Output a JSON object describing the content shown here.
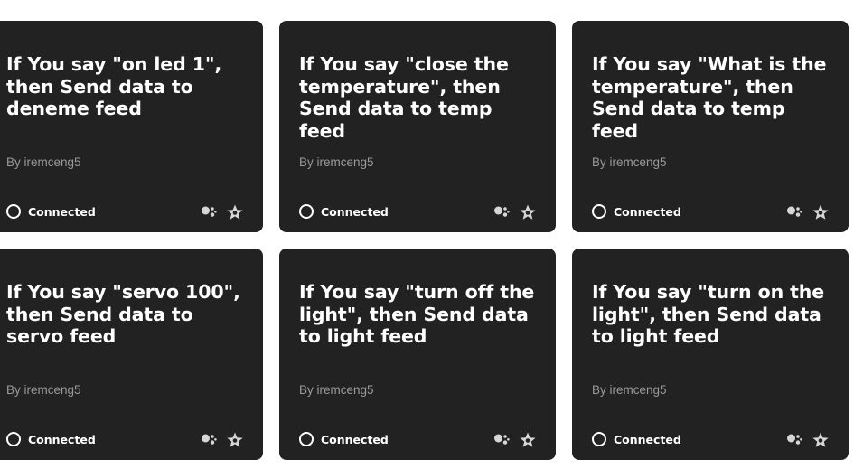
{
  "cards": [
    {
      "title": "If You say \"on led 1\", then Send data to deneme feed",
      "author": "By iremceng5",
      "status": "Connected",
      "service_icons": [
        "google-assistant-icon",
        "adafruit-star-icon"
      ]
    },
    {
      "title": "If You say \"close the temperature\", then Send data to temp feed",
      "author": "By iremceng5",
      "status": "Connected",
      "service_icons": [
        "google-assistant-icon",
        "adafruit-star-icon"
      ]
    },
    {
      "title": "If You say \"What is the temperature\", then Send data to temp feed",
      "author": "By iremceng5",
      "status": "Connected",
      "service_icons": [
        "google-assistant-icon",
        "adafruit-star-icon"
      ]
    },
    {
      "title": "If You say \"servo 100\", then Send data to servo feed",
      "author": "By iremceng5",
      "status": "Connected",
      "service_icons": [
        "google-assistant-icon",
        "adafruit-star-icon"
      ]
    },
    {
      "title": "If You say \"turn off the light\", then Send data to light feed",
      "author": "By iremceng5",
      "status": "Connected",
      "service_icons": [
        "google-assistant-icon",
        "adafruit-star-icon"
      ]
    },
    {
      "title": "If You say \"turn on the light\", then Send data to light feed",
      "author": "By iremceng5",
      "status": "Connected",
      "service_icons": [
        "google-assistant-icon",
        "adafruit-star-icon"
      ]
    }
  ],
  "colors": {
    "card_background": "#222222",
    "title_text": "#ffffff",
    "author_text": "#9a9a9a",
    "page_background": "#ffffff"
  }
}
